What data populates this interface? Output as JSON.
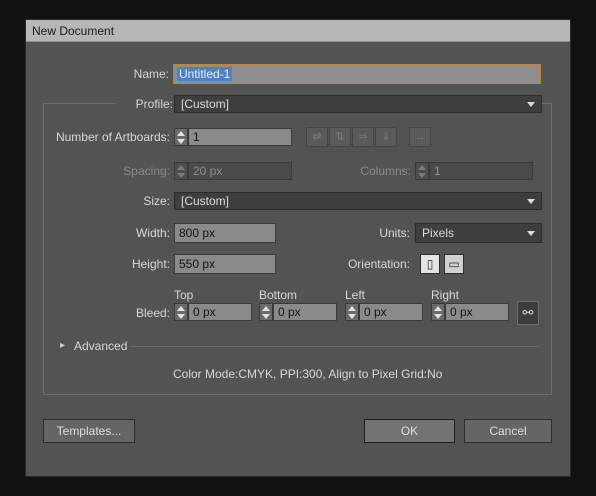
{
  "title": "New Document",
  "name": {
    "label": "Name:",
    "value": "Untitled-1"
  },
  "profile": {
    "label": "Profile:",
    "value": "[Custom]"
  },
  "artboards": {
    "label": "Number of Artboards:",
    "value": "1",
    "arrow_icon": "→"
  },
  "spacing": {
    "label": "Spacing:",
    "value": "20 px"
  },
  "columns": {
    "label": "Columns:",
    "value": "1"
  },
  "size": {
    "label": "Size:",
    "value": "[Custom]"
  },
  "width": {
    "label": "Width:",
    "value": "800 px"
  },
  "height": {
    "label": "Height:",
    "value": "550 px"
  },
  "units": {
    "label": "Units:",
    "value": "Pixels"
  },
  "orientation": {
    "label": "Orientation:"
  },
  "bleed": {
    "label": "Bleed:",
    "top": {
      "label": "Top",
      "value": "0 px"
    },
    "bottom": {
      "label": "Bottom",
      "value": "0 px"
    },
    "left": {
      "label": "Left",
      "value": "0 px"
    },
    "right": {
      "label": "Right",
      "value": "0 px"
    },
    "link_icon": "⚯"
  },
  "advanced": {
    "label": "Advanced",
    "icon": "▸"
  },
  "summary": "Color Mode:CMYK, PPI:300, Align to Pixel Grid:No",
  "buttons": {
    "templates": "Templates...",
    "ok": "OK",
    "cancel": "Cancel"
  },
  "colors": {
    "accent": "#c9822a",
    "selection": "#4f7fc4",
    "panel": "#535353"
  }
}
